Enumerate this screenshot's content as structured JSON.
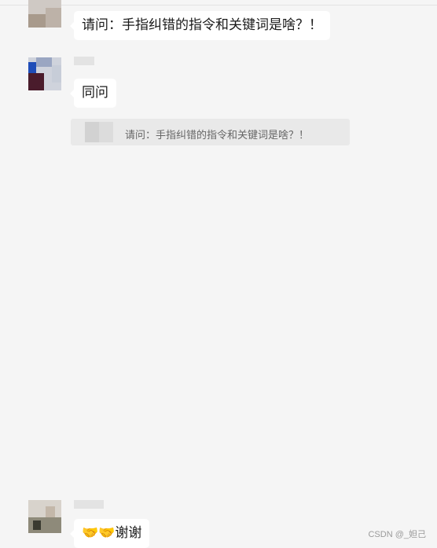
{
  "messages": [
    {
      "text": "请问：手指纠错的指令和关键词是啥？！"
    },
    {
      "text": "同问",
      "quote": {
        "text": "请问：手指纠错的指令和关键词是啥？！"
      }
    },
    {
      "emoji": "🤝🤝",
      "text": "谢谢"
    }
  ],
  "watermark": "CSDN @_妲己",
  "colors": {
    "background": "#f5f5f5",
    "bubble": "#ffffff",
    "quote": "#e9e9e9"
  }
}
